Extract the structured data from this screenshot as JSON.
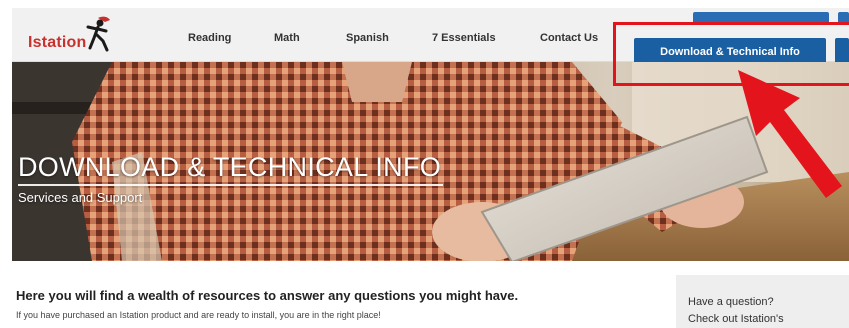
{
  "brand": {
    "logo_text": "Istation",
    "accent": "#c8312e"
  },
  "nav": {
    "items": [
      "Reading",
      "Math",
      "Spanish",
      "7 Essentials",
      "Contact Us"
    ]
  },
  "header_buttons": {
    "primary_label": "Download & Technical Info",
    "primary_color": "#1b5fa3"
  },
  "annotation": {
    "highlight_color": "#e3141b",
    "arrow_color": "#e3141b"
  },
  "hero": {
    "title": "DOWNLOAD & TECHNICAL INFO",
    "subtitle": "Services and Support"
  },
  "content": {
    "heading": "Here you will find a wealth of resources to answer any questions you might have.",
    "text": "If you have purchased an Istation product and are ready to install, you are in the right place!"
  },
  "sidebar": {
    "line1": "Have a question?",
    "line2": "Check out Istation's"
  }
}
